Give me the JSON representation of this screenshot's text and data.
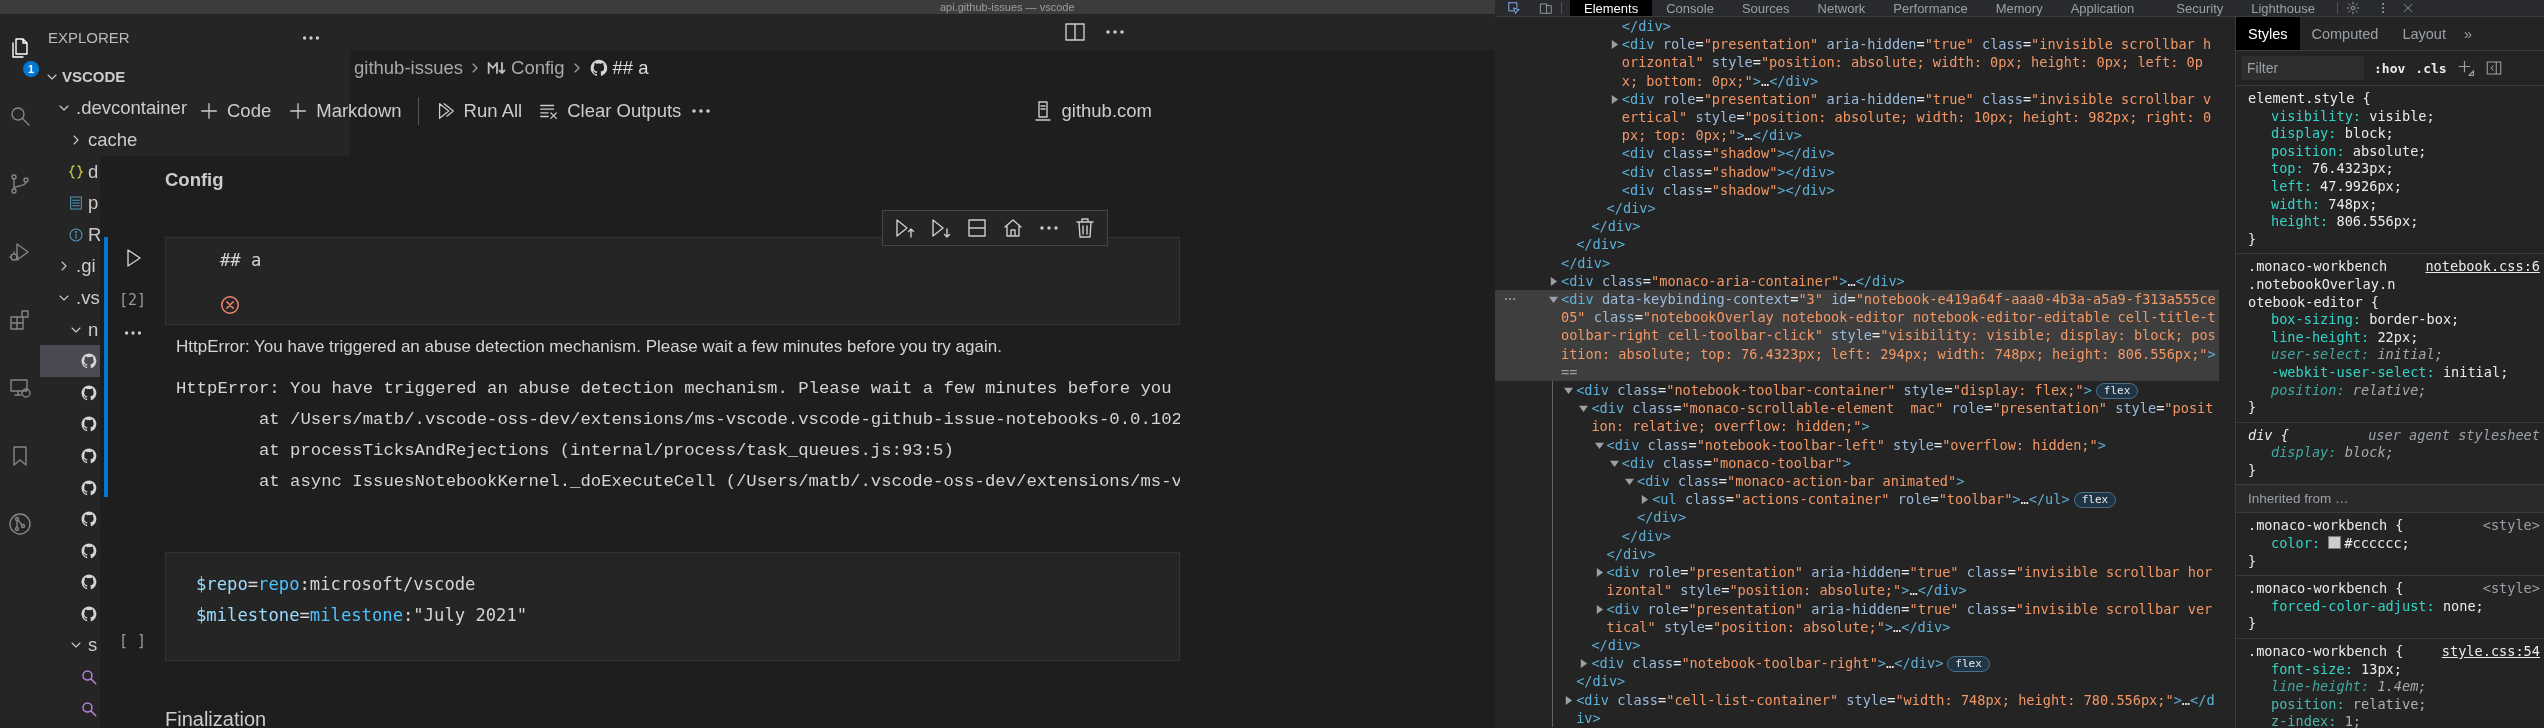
{
  "window": {
    "title": "api.github-issues — vscode"
  },
  "activity_bar": [
    {
      "selected": true,
      "badge": "1"
    },
    {
      "selected": false
    },
    {
      "selected": false
    },
    {
      "selected": false
    },
    {
      "selected": false
    },
    {
      "selected": false
    },
    {
      "selected": false
    },
    {
      "selected": false
    }
  ],
  "explorer": {
    "title": "EXPLORER",
    "root": {
      "label": "VSCODE",
      "expanded": true
    },
    "tree": [
      {
        "kind": "folder",
        "label": ".devcontainer",
        "expanded": true,
        "selected": false,
        "children": [
          {
            "kind": "folder",
            "label": "cache",
            "expanded": false,
            "selected": false
          },
          {
            "kind": "json",
            "label": "d",
            "selected": false
          },
          {
            "kind": "doc",
            "label": "p",
            "selected": false
          },
          {
            "kind": "info",
            "label": "R",
            "selected": false
          }
        ]
      },
      {
        "kind": "folder",
        "label": ".gi",
        "expanded": false,
        "selected": false
      },
      {
        "kind": "folder",
        "label": ".vs",
        "expanded": true,
        "selected": false,
        "children": [
          {
            "kind": "folder",
            "label": "n",
            "expanded": true,
            "selected": false,
            "children": [
              {
                "kind": "notebook",
                "selected": true
              },
              {
                "kind": "notebook",
                "selected": false
              },
              {
                "kind": "notebook",
                "selected": false
              },
              {
                "kind": "notebook",
                "selected": false
              },
              {
                "kind": "notebook",
                "selected": false
              },
              {
                "kind": "notebook",
                "selected": false
              },
              {
                "kind": "notebook",
                "selected": false
              },
              {
                "kind": "notebook",
                "selected": false
              },
              {
                "kind": "notebook",
                "selected": false
              }
            ]
          },
          {
            "kind": "folder",
            "label": "s",
            "expanded": true,
            "selected": false,
            "children": [
              {
                "kind": "query",
                "selected": false
              },
              {
                "kind": "query",
                "selected": false
              }
            ]
          }
        ]
      }
    ]
  },
  "editor": {
    "breadcrumbs": [
      {
        "kind": "folder",
        "label": "github-issues"
      },
      {
        "kind": "markdown",
        "label": "Config"
      },
      {
        "kind": "notebook",
        "label": "## a"
      }
    ]
  },
  "notebook": {
    "toolbar": [
      {
        "kind": "add",
        "label": "Code"
      },
      {
        "kind": "add",
        "label": "Markdown"
      },
      {
        "kind": "run-all",
        "label": "Run All"
      },
      {
        "kind": "clear",
        "label": "Clear Outputs"
      }
    ],
    "kernel": {
      "label": "github.com"
    },
    "cells": [
      {
        "kind": "markup-strong",
        "text": "Config",
        "selected": false
      },
      {
        "kind": "code",
        "selected": true,
        "error": true,
        "execution_count": "[2]",
        "source": [
          [
            {
              "text": "## a",
              "color": "#d4d4d4"
            }
          ]
        ],
        "outputs": [
          {
            "kind": "message",
            "text": "HttpError: You have triggered an abuse detection mechanism. Please wait a few minutes before you try again."
          },
          {
            "kind": "stack",
            "lines": [
              "HttpError: You have triggered an abuse detection mechanism. Please wait a few minutes before you",
              "        at /Users/matb/.vscode-oss-dev/extensions/ms-vscode.vscode-github-issue-notebooks-0.0.102",
              "        at processTicksAndRejections (internal/process/task_queues.js:93:5)",
              "        at async IssuesNotebookKernel._doExecuteCell (/Users/matb/.vscode-oss-dev/extensions/ms-v"
            ]
          }
        ]
      },
      {
        "kind": "code",
        "selected": false,
        "execution_count": "[ ]",
        "source": [
          [
            {
              "text": "$repo",
              "color": "#9cdcfe"
            },
            {
              "text": "=",
              "color": "#d4d4d4"
            },
            {
              "text": "repo",
              "color": "#4fc1ff"
            },
            {
              "text": ":microsoft/vscode",
              "color": "#d4d4d4"
            }
          ],
          [
            {
              "text": "$milestone",
              "color": "#9cdcfe"
            },
            {
              "text": "=",
              "color": "#d4d4d4"
            },
            {
              "text": "milestone",
              "color": "#4fc1ff"
            },
            {
              "text": ":\"July 2021\"",
              "color": "#d4d4d4"
            }
          ]
        ]
      },
      {
        "kind": "markup-title",
        "text": "Finalization",
        "selected": false
      }
    ]
  },
  "devtools": {
    "tabs": [
      {
        "label": "Elements",
        "selected": true
      },
      {
        "label": "Console",
        "selected": false
      },
      {
        "label": "Sources",
        "selected": false
      },
      {
        "label": "Network",
        "selected": false
      },
      {
        "label": "Performance",
        "selected": false
      },
      {
        "label": "Memory",
        "selected": false
      },
      {
        "label": "Application",
        "selected": false
      },
      {
        "label": "Security",
        "selected": false
      },
      {
        "label": "Lighthouse",
        "selected": false
      }
    ],
    "elements": {
      "tree": [
        {
          "children": [
            {
              "children": [
                {
                  "children": [
                    {
                      "children": [
                        {
                          "close": "</div>"
                        },
                        {
                          "open": "<div role=\"presentation\" aria-hidden=\"true\" class=\"invisible scrollbar horizontal\" style=\"position: absolute; width: 0px; height: 0px; left: 0px; bottom: 0px;\">…</div>",
                          "expanded": false,
                          "selected": false
                        },
                        {
                          "open": "<div role=\"presentation\" aria-hidden=\"true\" class=\"invisible scrollbar vertical\" style=\"position: absolute; width: 10px; height: 982px; right: 0px; top: 0px;\">…</div>",
                          "expanded": false,
                          "selected": false
                        },
                        {
                          "open": "<div class=\"shadow\"></div>",
                          "selected": false
                        },
                        {
                          "open": "<div class=\"shadow\"></div>",
                          "selected": false
                        },
                        {
                          "open": "<div class=\"shadow\"></div>",
                          "selected": false
                        }
                      ],
                      "close": "</div>"
                    }
                  ],
                  "close": "</div>"
                }
              ],
              "close": "</div>"
            }
          ],
          "close": "</div>"
        },
        {
          "open": "<div class=\"monaco-aria-container\">…</div>",
          "expanded": false,
          "selected": false
        },
        {
          "open": "<div data-keybinding-context=\"3\" id=\"notebook-e419a64f-aaa0-4b3a-a5a9-f313a555ce05\" class=\"notebookOverlay notebook-editor notebook-editor-editable cell-title-toolbar-right cell-toolbar-click\" style=\"visibility: visible; display: block; position: absolute; top: 76.4323px; left: 294px; width: 748px; height: 806.556px;\">",
          "marker": "==",
          "expanded": true,
          "selected": true,
          "children": [
            {
              "open": "<div class=\"notebook-toolbar-container\" style=\"display: flex;\">",
              "badge": "flex",
              "expanded": true,
              "selected": false,
              "children": [
                {
                  "open": "<div class=\"monaco-scrollable-element  mac\" role=\"presentation\" style=\"position: relative; overflow: hidden;\">",
                  "expanded": true,
                  "selected": false,
                  "children": [
                    {
                      "open": "<div class=\"notebook-toolbar-left\" style=\"overflow: hidden;\">",
                      "expanded": true,
                      "selected": false,
                      "children": [
                        {
                          "open": "<div class=\"monaco-toolbar\">",
                          "expanded": true,
                          "selected": false,
                          "children": [
                            {
                              "open": "<div class=\"monaco-action-bar animated\">",
                              "expanded": true,
                              "selected": false,
                              "children": [
                                {
                                  "open": "<ul class=\"actions-container\" role=\"toolbar\">…</ul>",
                                  "badge": "flex",
                                  "expanded": false,
                                  "selected": false
                                }
                              ],
                              "close": "</div>"
                            }
                          ],
                          "close": "</div>"
                        }
                      ],
                      "close": "</div>"
                    },
                    {
                      "open": "<div role=\"presentation\" aria-hidden=\"true\" class=\"invisible scrollbar horizontal\" style=\"position: absolute;\">…</div>",
                      "expanded": false,
                      "selected": false
                    },
                    {
                      "open": "<div role=\"presentation\" aria-hidden=\"true\" class=\"invisible scrollbar vertical\" style=\"position: absolute;\">…</div>",
                      "expanded": false,
                      "selected": false
                    }
                  ],
                  "close": "</div>"
                },
                {
                  "open": "<div class=\"notebook-toolbar-right\">…</div>",
                  "badge": "flex",
                  "expanded": false,
                  "selected": false
                }
              ],
              "close": "</div>"
            },
            {
              "open": "<div class=\"cell-list-container\" style=\"width: 748px; height: 780.556px;\">…</div>",
              "expanded": false,
              "selected": false
            }
          ]
        }
      ]
    },
    "styles": {
      "tabs": [
        {
          "label": "Styles",
          "selected": true
        },
        {
          "label": "Computed",
          "selected": false
        },
        {
          "label": "Layout",
          "selected": false
        }
      ],
      "overflow": "»",
      "filter": {
        "placeholder": "Filter"
      },
      "toggles": [
        ":hov",
        ".cls"
      ],
      "rules": [
        {
          "kind": "rule",
          "selector": "element.style {",
          "props": [
            {
              "name": "visibility:",
              "value": "visible;",
              "overridden": false,
              "inactive": false
            },
            {
              "name": "display:",
              "value": "block;",
              "overridden": false,
              "inactive": false
            },
            {
              "name": "position:",
              "value": "absolute;",
              "overridden": false,
              "inactive": false
            },
            {
              "name": "top:",
              "value": "76.4323px;",
              "overridden": false,
              "inactive": false
            },
            {
              "name": "left:",
              "value": "47.9926px;",
              "overridden": false,
              "inactive": false
            },
            {
              "name": "width:",
              "value": "748px;",
              "overridden": false,
              "inactive": false
            },
            {
              "name": "height:",
              "value": "806.556px;",
              "overridden": false,
              "inactive": false
            }
          ],
          "close": "}"
        },
        {
          "kind": "rule",
          "selector": ".monaco-workbench .notebookOverlay.notebook-editor {",
          "source": "notebook.css:6",
          "linked": true,
          "props": [
            {
              "name": "box-sizing:",
              "value": "border-box;",
              "overridden": false,
              "inactive": false
            },
            {
              "name": "line-height:",
              "value": "22px;",
              "overridden": false,
              "inactive": false
            },
            {
              "name": "user-select:",
              "value": "initial;",
              "overridden": true,
              "inactive": false
            },
            {
              "name": "-webkit-user-select:",
              "value": "initial;",
              "overridden": false,
              "inactive": false
            },
            {
              "name": "position:",
              "value": "relative;",
              "overridden": true,
              "inactive": false
            }
          ],
          "close": "}"
        },
        {
          "kind": "user-agent",
          "selector": "div {",
          "source": "user agent stylesheet",
          "linked": false,
          "props": [
            {
              "name": "display:",
              "value": "block;",
              "overridden": true,
              "inactive": false
            }
          ],
          "close": "}"
        },
        {
          "kind": "header",
          "text": "Inherited from …"
        },
        {
          "kind": "rule",
          "selector": ".monaco-workbench {",
          "source": "<style>",
          "linked": false,
          "props": [
            {
              "name": "color:",
              "value": "#cccccc;",
              "color": "#cccccc",
              "overridden": false,
              "inactive": false
            }
          ],
          "close": "}"
        },
        {
          "kind": "rule",
          "selector": ".monaco-workbench {",
          "source": "<style>",
          "linked": false,
          "props": [
            {
              "name": "forced-color-adjust:",
              "value": "none;",
              "overridden": false,
              "inactive": false
            }
          ],
          "close": "}"
        },
        {
          "kind": "rule",
          "selector": ".monaco-workbench {",
          "source": "style.css:54",
          "linked": true,
          "props": [
            {
              "name": "font-size:",
              "value": "13px;",
              "overridden": false,
              "inactive": false
            },
            {
              "name": "line-height:",
              "value": "1.4em;",
              "overridden": true,
              "inactive": false
            },
            {
              "name": "position:",
              "value": "relative;",
              "overridden": false,
              "inactive": true
            },
            {
              "name": "z-index:",
              "value": "1;",
              "overridden": false,
              "inactive": true
            }
          ]
        }
      ]
    }
  }
}
